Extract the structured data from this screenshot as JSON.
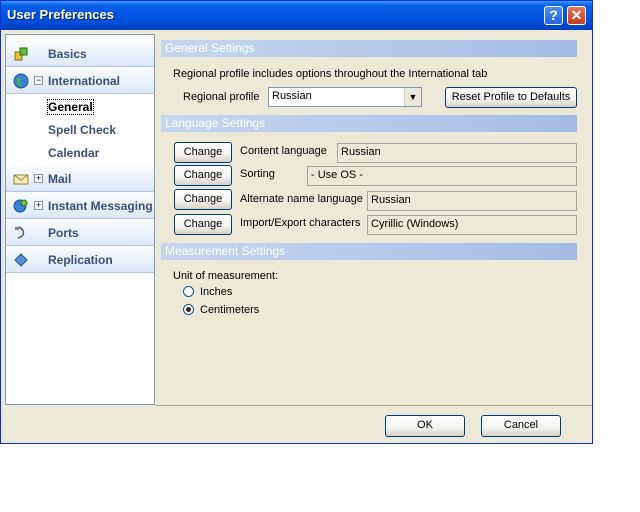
{
  "window": {
    "title": "User Preferences",
    "help_glyph": "?",
    "close_glyph": "✕"
  },
  "nav": {
    "basics": "Basics",
    "international": "International",
    "international_expander": "−",
    "general": "General",
    "spell_check": "Spell Check",
    "calendar": "Calendar",
    "mail": "Mail",
    "mail_expander": "+",
    "instant_messaging": "Instant Messaging",
    "im_expander": "+",
    "ports": "Ports",
    "replication": "Replication"
  },
  "general_settings": {
    "header": "General Settings",
    "intro": "Regional profile includes options throughout the International tab",
    "regional_profile_label": "Regional profile",
    "regional_profile_value": "Russian",
    "reset_button": "Reset Profile to Defaults"
  },
  "language_settings": {
    "header": "Language Settings",
    "change_label": "Change",
    "rows": [
      {
        "label": "Content language",
        "value": "Russian"
      },
      {
        "label": "Sorting",
        "value": "- Use OS -"
      },
      {
        "label": "Alternate name language",
        "value": "Russian"
      },
      {
        "label": "Import/Export characters",
        "value": "Cyrillic (Windows)"
      }
    ]
  },
  "measurement_settings": {
    "header": "Measurement Settings",
    "unit_label": "Unit of measurement:",
    "options": [
      "Inches",
      "Centimeters"
    ],
    "selected": "Centimeters"
  },
  "footer": {
    "ok": "OK",
    "cancel": "Cancel"
  },
  "colors": {
    "titlebar": "#0054e3",
    "section_header": "#a4bce5",
    "nav_label": "#3c4f7a"
  }
}
